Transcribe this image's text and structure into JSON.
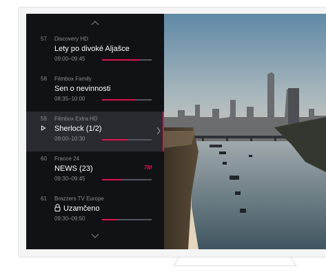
{
  "channels": [
    {
      "number": "57",
      "name": "Discovery HD",
      "title": "Lety po divoké Aljašce",
      "time": "09:00–09:45",
      "progress": 0.75
    },
    {
      "number": "58",
      "name": "Filmbox Family",
      "title": "Sen o nevinnosti",
      "time": "08:35–10:00",
      "progress": 0.68
    },
    {
      "number": "59",
      "name": "Filmbox Extra HD",
      "title": "Sherlock (1/2)",
      "time": "09:00–10:30",
      "progress": 0.52,
      "selected": true
    },
    {
      "number": "60",
      "name": "France 24",
      "title": "NEWS (23)",
      "time": "09:30–09:45",
      "progress": 0.4,
      "badge": "7M"
    },
    {
      "number": "61",
      "name": "Brazzers TV Europe",
      "title": "Uzamčeno",
      "time": "09:30–09:50",
      "progress": 0.3,
      "locked": true
    }
  ],
  "colors": {
    "accent": "#e0144f",
    "panel": "#111216",
    "selected": "#2a2b31"
  },
  "icons": {
    "up": "chevron-up-icon",
    "down": "chevron-down-icon",
    "play": "play-icon",
    "lock": "lock-icon",
    "next": "chevron-right-icon"
  }
}
